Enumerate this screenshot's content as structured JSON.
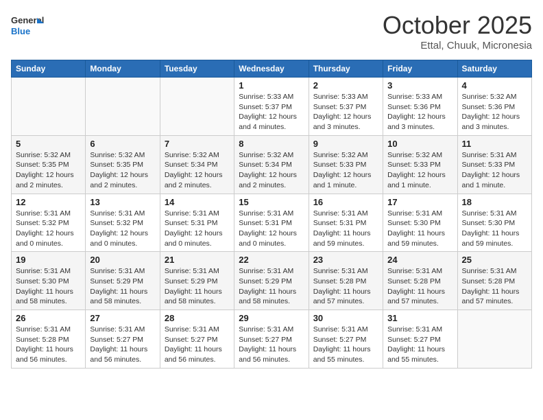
{
  "header": {
    "logo_line1": "General",
    "logo_line2": "Blue",
    "month": "October 2025",
    "location": "Ettal, Chuuk, Micronesia"
  },
  "weekdays": [
    "Sunday",
    "Monday",
    "Tuesday",
    "Wednesday",
    "Thursday",
    "Friday",
    "Saturday"
  ],
  "weeks": [
    [
      {
        "date": "",
        "info": ""
      },
      {
        "date": "",
        "info": ""
      },
      {
        "date": "",
        "info": ""
      },
      {
        "date": "1",
        "info": "Sunrise: 5:33 AM\nSunset: 5:37 PM\nDaylight: 12 hours\nand 4 minutes."
      },
      {
        "date": "2",
        "info": "Sunrise: 5:33 AM\nSunset: 5:37 PM\nDaylight: 12 hours\nand 3 minutes."
      },
      {
        "date": "3",
        "info": "Sunrise: 5:33 AM\nSunset: 5:36 PM\nDaylight: 12 hours\nand 3 minutes."
      },
      {
        "date": "4",
        "info": "Sunrise: 5:32 AM\nSunset: 5:36 PM\nDaylight: 12 hours\nand 3 minutes."
      }
    ],
    [
      {
        "date": "5",
        "info": "Sunrise: 5:32 AM\nSunset: 5:35 PM\nDaylight: 12 hours\nand 2 minutes."
      },
      {
        "date": "6",
        "info": "Sunrise: 5:32 AM\nSunset: 5:35 PM\nDaylight: 12 hours\nand 2 minutes."
      },
      {
        "date": "7",
        "info": "Sunrise: 5:32 AM\nSunset: 5:34 PM\nDaylight: 12 hours\nand 2 minutes."
      },
      {
        "date": "8",
        "info": "Sunrise: 5:32 AM\nSunset: 5:34 PM\nDaylight: 12 hours\nand 2 minutes."
      },
      {
        "date": "9",
        "info": "Sunrise: 5:32 AM\nSunset: 5:33 PM\nDaylight: 12 hours\nand 1 minute."
      },
      {
        "date": "10",
        "info": "Sunrise: 5:32 AM\nSunset: 5:33 PM\nDaylight: 12 hours\nand 1 minute."
      },
      {
        "date": "11",
        "info": "Sunrise: 5:31 AM\nSunset: 5:33 PM\nDaylight: 12 hours\nand 1 minute."
      }
    ],
    [
      {
        "date": "12",
        "info": "Sunrise: 5:31 AM\nSunset: 5:32 PM\nDaylight: 12 hours\nand 0 minutes."
      },
      {
        "date": "13",
        "info": "Sunrise: 5:31 AM\nSunset: 5:32 PM\nDaylight: 12 hours\nand 0 minutes."
      },
      {
        "date": "14",
        "info": "Sunrise: 5:31 AM\nSunset: 5:31 PM\nDaylight: 12 hours\nand 0 minutes."
      },
      {
        "date": "15",
        "info": "Sunrise: 5:31 AM\nSunset: 5:31 PM\nDaylight: 12 hours\nand 0 minutes."
      },
      {
        "date": "16",
        "info": "Sunrise: 5:31 AM\nSunset: 5:31 PM\nDaylight: 11 hours\nand 59 minutes."
      },
      {
        "date": "17",
        "info": "Sunrise: 5:31 AM\nSunset: 5:30 PM\nDaylight: 11 hours\nand 59 minutes."
      },
      {
        "date": "18",
        "info": "Sunrise: 5:31 AM\nSunset: 5:30 PM\nDaylight: 11 hours\nand 59 minutes."
      }
    ],
    [
      {
        "date": "19",
        "info": "Sunrise: 5:31 AM\nSunset: 5:30 PM\nDaylight: 11 hours\nand 58 minutes."
      },
      {
        "date": "20",
        "info": "Sunrise: 5:31 AM\nSunset: 5:29 PM\nDaylight: 11 hours\nand 58 minutes."
      },
      {
        "date": "21",
        "info": "Sunrise: 5:31 AM\nSunset: 5:29 PM\nDaylight: 11 hours\nand 58 minutes."
      },
      {
        "date": "22",
        "info": "Sunrise: 5:31 AM\nSunset: 5:29 PM\nDaylight: 11 hours\nand 58 minutes."
      },
      {
        "date": "23",
        "info": "Sunrise: 5:31 AM\nSunset: 5:28 PM\nDaylight: 11 hours\nand 57 minutes."
      },
      {
        "date": "24",
        "info": "Sunrise: 5:31 AM\nSunset: 5:28 PM\nDaylight: 11 hours\nand 57 minutes."
      },
      {
        "date": "25",
        "info": "Sunrise: 5:31 AM\nSunset: 5:28 PM\nDaylight: 11 hours\nand 57 minutes."
      }
    ],
    [
      {
        "date": "26",
        "info": "Sunrise: 5:31 AM\nSunset: 5:28 PM\nDaylight: 11 hours\nand 56 minutes."
      },
      {
        "date": "27",
        "info": "Sunrise: 5:31 AM\nSunset: 5:27 PM\nDaylight: 11 hours\nand 56 minutes."
      },
      {
        "date": "28",
        "info": "Sunrise: 5:31 AM\nSunset: 5:27 PM\nDaylight: 11 hours\nand 56 minutes."
      },
      {
        "date": "29",
        "info": "Sunrise: 5:31 AM\nSunset: 5:27 PM\nDaylight: 11 hours\nand 56 minutes."
      },
      {
        "date": "30",
        "info": "Sunrise: 5:31 AM\nSunset: 5:27 PM\nDaylight: 11 hours\nand 55 minutes."
      },
      {
        "date": "31",
        "info": "Sunrise: 5:31 AM\nSunset: 5:27 PM\nDaylight: 11 hours\nand 55 minutes."
      },
      {
        "date": "",
        "info": ""
      }
    ]
  ]
}
